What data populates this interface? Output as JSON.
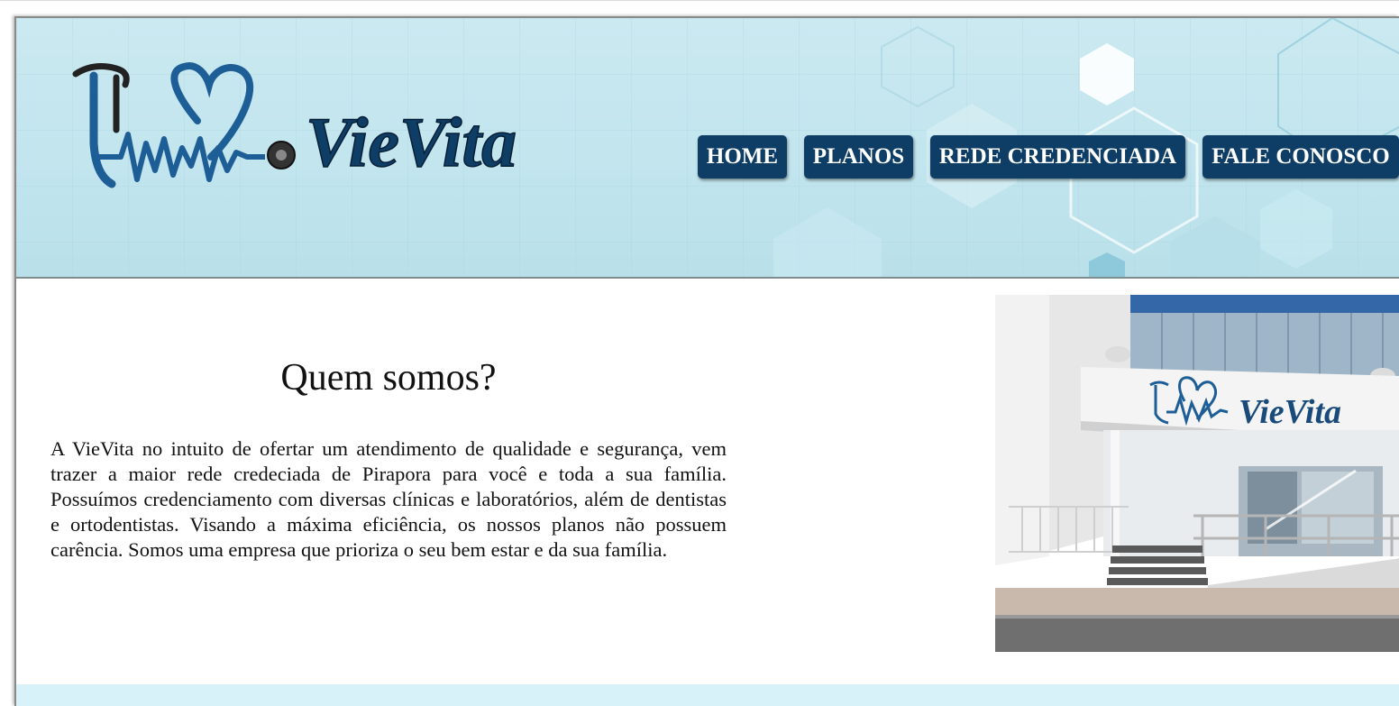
{
  "brand": {
    "name": "VieVita",
    "logo_icon": "stethoscope-heart-icon"
  },
  "nav": {
    "items": [
      {
        "label": "HOME"
      },
      {
        "label": "PLANOS"
      },
      {
        "label": "REDE CREDENCIADA"
      },
      {
        "label": "FALE CONOSCO"
      }
    ]
  },
  "about": {
    "title": "Quem somos?",
    "text": "A VieVita no intuito de ofertar um atendimento de qualidade e segurança, vem trazer a maior rede credeciada de Pirapora para você e toda a sua família. Possuímos credenciamento com diversas clínicas e laboratórios, além de dentistas e ortodentistas. Visando a máxima eficiência, os nossos planos não possuem carência. Somos uma empresa que prioriza o seu bem estar e da sua família."
  },
  "photo": {
    "sign_text": "VieVita"
  },
  "colors": {
    "nav_bg": "#0e3e66",
    "header_bg": "#c2e5ee",
    "logo_text": "#0e3e66",
    "footer_band": "#d8f2fa"
  }
}
